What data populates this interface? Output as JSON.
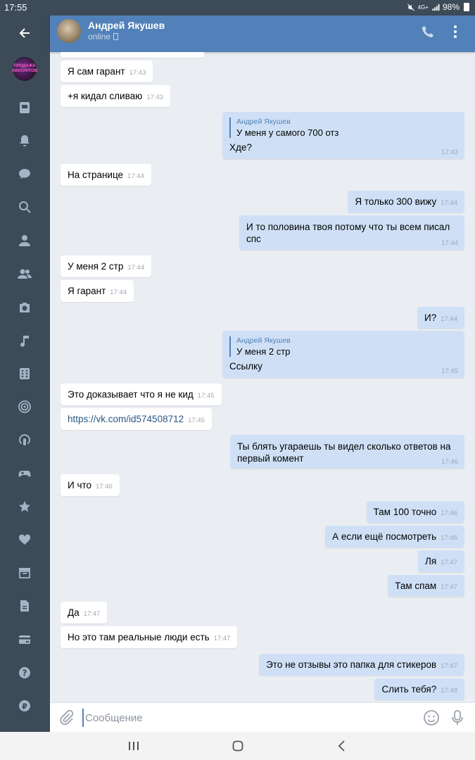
{
  "status_bar": {
    "time": "17:55",
    "network": "4G+",
    "battery": "98%"
  },
  "sidebar": {
    "items": [
      {
        "name": "back-arrow-icon"
      },
      {
        "name": "group-avatar",
        "text": "ПРОДАЖА АККАУНТОВ"
      },
      {
        "name": "news-icon"
      },
      {
        "name": "notifications-icon"
      },
      {
        "name": "messages-icon"
      },
      {
        "name": "search-icon"
      },
      {
        "name": "profile-icon"
      },
      {
        "name": "friends-icon"
      },
      {
        "name": "photos-icon"
      },
      {
        "name": "music-icon"
      },
      {
        "name": "apps-icon"
      },
      {
        "name": "target-icon"
      },
      {
        "name": "podcasts-icon"
      },
      {
        "name": "games-icon"
      },
      {
        "name": "favorites-icon"
      },
      {
        "name": "likes-icon"
      },
      {
        "name": "archive-icon"
      },
      {
        "name": "documents-icon"
      },
      {
        "name": "payments-icon"
      },
      {
        "name": "help-icon"
      },
      {
        "name": "money-transfer-icon"
      }
    ]
  },
  "header": {
    "name": "Андрей Якушев",
    "status": "online"
  },
  "messages": [
    {
      "dir": "in",
      "text": "Я сам гарант",
      "time": "17:43"
    },
    {
      "dir": "in",
      "text": "+я кидал сливаю",
      "time": "17:43"
    },
    {
      "dir": "out",
      "reply_name": "Андрей Якушев",
      "reply_text": "У меня у самого 700 отз",
      "text": "Хде?",
      "time": "17:43"
    },
    {
      "dir": "in",
      "text": "На странице",
      "time": "17:44"
    },
    {
      "dir": "out",
      "text": "Я только 300 вижу",
      "time": "17:44"
    },
    {
      "dir": "out",
      "text": "И то половина твоя потому что ты всем писал спс",
      "time": "17:44"
    },
    {
      "dir": "in",
      "text": "У меня 2 стр",
      "time": "17:44"
    },
    {
      "dir": "in",
      "text": "Я гарант",
      "time": "17:44"
    },
    {
      "dir": "out",
      "text": "И?",
      "time": "17:44"
    },
    {
      "dir": "out",
      "reply_name": "Андрей Якушев",
      "reply_text": "У меня 2 стр",
      "text": "Ссылку",
      "time": "17:45"
    },
    {
      "dir": "in",
      "text": "Это доказывает что я не кид",
      "time": "17:45"
    },
    {
      "dir": "in",
      "text": "https://vk.com/id574508712",
      "time": "17:45"
    },
    {
      "dir": "out",
      "text": "Ты блять угараешь ты видел сколько ответов на первый комент",
      "time": "17:46"
    },
    {
      "dir": "in",
      "text": "И что",
      "time": "17:46"
    },
    {
      "dir": "out",
      "text": "Там 100 точно",
      "time": "17:46"
    },
    {
      "dir": "out",
      "text": "А если ещё посмотреть",
      "time": "17:46"
    },
    {
      "dir": "out",
      "text": "Ля",
      "time": "17:47"
    },
    {
      "dir": "out",
      "text": "Там спам",
      "time": "17:47"
    },
    {
      "dir": "in",
      "text": "Да",
      "time": "17:47"
    },
    {
      "dir": "in",
      "text": "Но это там реальные люди есть",
      "time": "17:47"
    },
    {
      "dir": "out",
      "text": "Это не отзывы это папка для стикеров",
      "time": "17:47"
    },
    {
      "dir": "out",
      "text": "Слить тебя?",
      "time": "17:48"
    }
  ],
  "input": {
    "placeholder": "Сообщение"
  },
  "colors": {
    "header": "#5181b8",
    "sidebar": "#3d4a58",
    "outgoing": "#cfe0f6",
    "incoming": "#ffffff"
  }
}
